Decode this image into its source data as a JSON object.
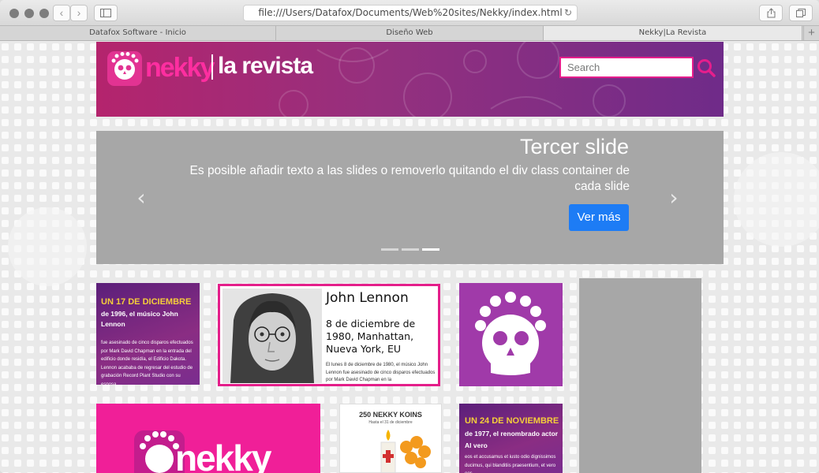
{
  "browser": {
    "url": "file:///Users/Datafox/Documents/Web%20sites/Nekky/index.html",
    "back_glyph": "‹",
    "forward_glyph": "›",
    "reload_glyph": "↻",
    "tabs": [
      {
        "label": "Datafox Software - Inicio"
      },
      {
        "label": "Diseño Web"
      },
      {
        "label": "Nekky|La Revista"
      }
    ],
    "new_tab_glyph": "+"
  },
  "header": {
    "brand": "nekky",
    "subtitle": "la revista",
    "search_placeholder": "Search",
    "accent_color": "#e61e8c"
  },
  "carousel": {
    "title": "Tercer slide",
    "text": "Es posible añadir texto a las slides o removerlo quitando el div class container de cada slide",
    "button": "Ver más",
    "prev_glyph": "‹",
    "next_glyph": "›",
    "active_index": 2,
    "count": 3
  },
  "cards": {
    "december": {
      "title": "UN 17 DE DICIEMBRE",
      "subtitle": "de 1996, el músico John Lennon",
      "body": "fue asesinado de cinco disparos efectuados por Mark David Chapman en la entrada del edificio donde residía, el Edificio Dakota. Lennon acababa de regresar del estudio de grabación Record Plant Studio con su esposa."
    },
    "lennon": {
      "name": "John Lennon",
      "date": "8 de diciembre de 1980, Manhattan, Nueva York, EU",
      "desc": "El lunes 8 de diciembre de 1980, el músico John Lennon fue asesinado de cinco disparos efectuados por Mark David Chapman en la"
    },
    "nekky_brand": "nekky",
    "koins": {
      "title": "250 NEKKY KOINS",
      "subtitle": "Hasta el 31 de diciembre"
    },
    "november": {
      "title": "UN 24 DE NOVIEMBRE",
      "subtitle": "de 1977, el renombrado actor Al vero",
      "body": "eos et accusamus et iusto odio dignissimos ducimus, qui blanditiis praesentium, et vero eos"
    }
  }
}
